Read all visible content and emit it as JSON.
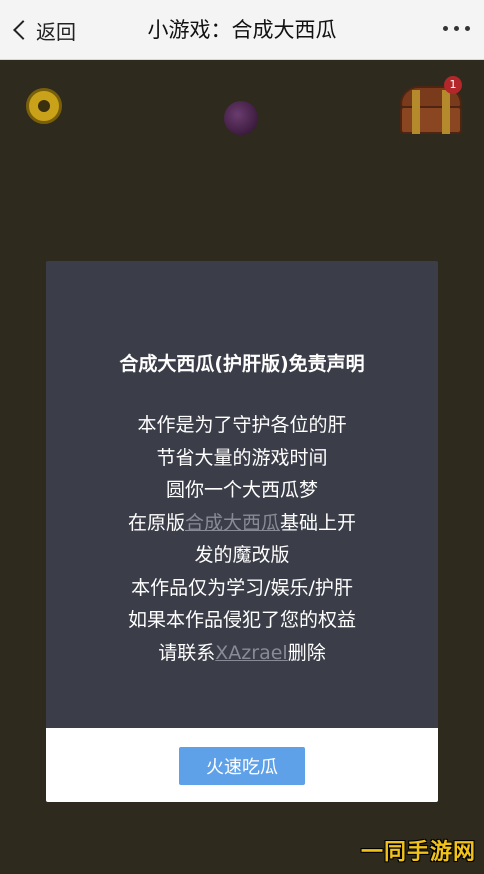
{
  "topbar": {
    "back_label": "返回",
    "title": "小游戏：合成大西瓜"
  },
  "game": {
    "chest_badge": "1"
  },
  "modal": {
    "heading": "合成大西瓜(护肝版)免责声明",
    "lines": {
      "l1": "本作是为了守护各位的肝",
      "l2": "节省大量的游戏时间",
      "l3": "圆你一个大西瓜梦",
      "l4_prefix": "在原版",
      "l4_link": "合成大西瓜",
      "l4_suffix": "基础上开",
      "l5": "发的魔改版",
      "l6": "本作品仅为学习/娱乐/护肝",
      "l7": "如果本作品侵犯了您的权益",
      "l8_prefix": "请联系",
      "l8_link": "XAzrael",
      "l8_suffix": "删除"
    },
    "button_label": "火速吃瓜"
  },
  "watermark": "一同手游网",
  "colors": {
    "topbar_bg": "#f4f4f4",
    "game_bg": "#2e2a1d",
    "modal_bg": "#3b3e49",
    "button_bg": "#5fa1e8",
    "link_color": "#888b96"
  }
}
